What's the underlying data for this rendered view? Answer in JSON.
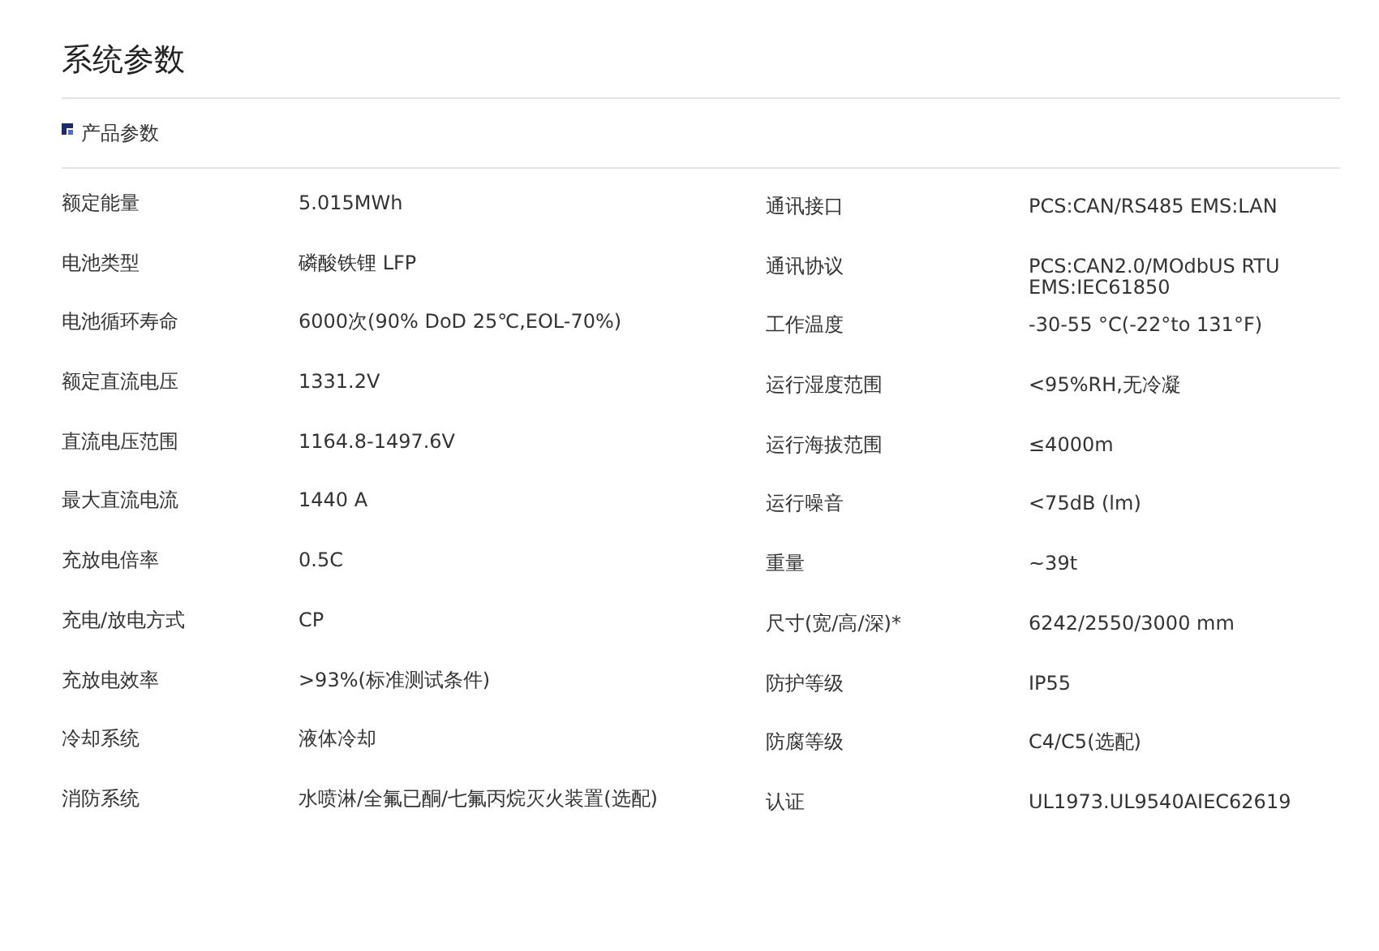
{
  "page_title": "系统参数",
  "section": {
    "title": "产品参数"
  },
  "columns": [
    {
      "rows": [
        {
          "label": "额定能量",
          "value": "5.015MWh"
        },
        {
          "label": "电池类型",
          "value": "磷酸铁锂 LFP"
        },
        {
          "label": "电池循环寿命",
          "value": "6000次(90% DoD 25℃,EOL-70%)"
        },
        {
          "label": "额定直流电压",
          "value": "1331.2V"
        },
        {
          "label": "直流电压范围",
          "value": "1164.8-1497.6V"
        },
        {
          "label": "最大直流电流",
          "value": "1440 A"
        },
        {
          "label": "充放电倍率",
          "value": "0.5C"
        },
        {
          "label": "充电/放电方式",
          "value": "CP"
        },
        {
          "label": "充放电效率",
          "value": ">93%(标准测试条件)"
        },
        {
          "label": "冷却系统",
          "value": "液体冷却"
        },
        {
          "label": "消防系统",
          "value": "水喷淋/全氟已酮/七氟丙烷灭火装置(选配)"
        }
      ]
    },
    {
      "rows": [
        {
          "label": "通讯接口",
          "value": "PCS:CAN/RS485 EMS:LAN"
        },
        {
          "label": "通讯协议",
          "value": "PCS:CAN2.0/MOdbUS RTU\nEMS:IEC61850"
        },
        {
          "label": "工作温度",
          "value": "-30-55 °C(-22°to 131°F)"
        },
        {
          "label": "运行湿度范围",
          "value": "<95%RH,无冷凝"
        },
        {
          "label": "运行海拔范围",
          "value": "≤4000m"
        },
        {
          "label": "运行噪音",
          "value": "<75dB (lm)"
        },
        {
          "label": "重量",
          "value": "~39t"
        },
        {
          "label": "尺寸(宽/高/深)*",
          "value": "6242/2550/3000 mm"
        },
        {
          "label": "防护等级",
          "value": "IP55"
        },
        {
          "label": "防腐等级",
          "value": "C4/C5(选配)"
        },
        {
          "label": "认证",
          "value": "UL1973.UL9540AIEC62619"
        }
      ]
    }
  ]
}
